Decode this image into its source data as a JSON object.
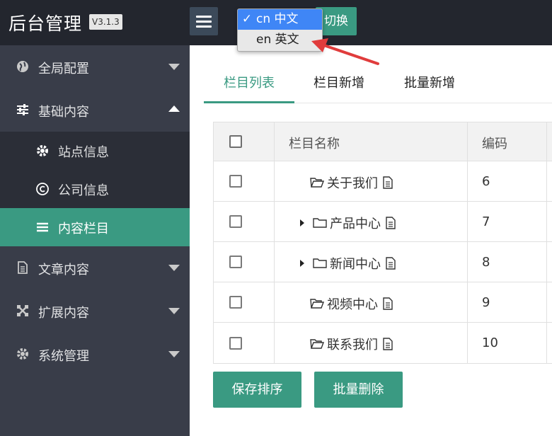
{
  "header": {
    "brand": "后台管理",
    "version": "V3.1.3",
    "switch_label": "切换"
  },
  "language_dropdown": {
    "options": [
      {
        "check": "✓",
        "label": "cn 中文",
        "selected": true
      },
      {
        "check": "",
        "label": "en 英文",
        "selected": false
      }
    ]
  },
  "sidebar": {
    "items": [
      {
        "label": "全局配置",
        "icon": "globe-icon"
      },
      {
        "label": "基础内容",
        "icon": "sliders-icon"
      },
      {
        "label": "文章内容",
        "icon": "document-icon"
      },
      {
        "label": "扩展内容",
        "icon": "expand-icon"
      },
      {
        "label": "系统管理",
        "icon": "gear-icon"
      }
    ],
    "subitems": [
      {
        "label": "站点信息",
        "icon": "gear-icon"
      },
      {
        "label": "公司信息",
        "icon": "copyright-icon"
      },
      {
        "label": "内容栏目",
        "icon": "list-icon",
        "active": true
      }
    ]
  },
  "tabs": [
    "栏目列表",
    "栏目新增",
    "批量新增"
  ],
  "table": {
    "headers": [
      "栏目名称",
      "编码"
    ],
    "rows": [
      {
        "name": "关于我们",
        "code": "6",
        "expandable": false
      },
      {
        "name": "产品中心",
        "code": "7",
        "expandable": true
      },
      {
        "name": "新闻中心",
        "code": "8",
        "expandable": true
      },
      {
        "name": "视频中心",
        "code": "9",
        "expandable": false
      },
      {
        "name": "联系我们",
        "code": "10",
        "expandable": false
      }
    ]
  },
  "buttons": {
    "save_sort": "保存排序",
    "batch_delete": "批量删除"
  },
  "colors": {
    "accent": "#3a9a82",
    "sidebar_bg": "#393d49",
    "header_bg": "#23262e",
    "dropdown_selected": "#3f86f6",
    "arrow": "#e03c3c"
  }
}
